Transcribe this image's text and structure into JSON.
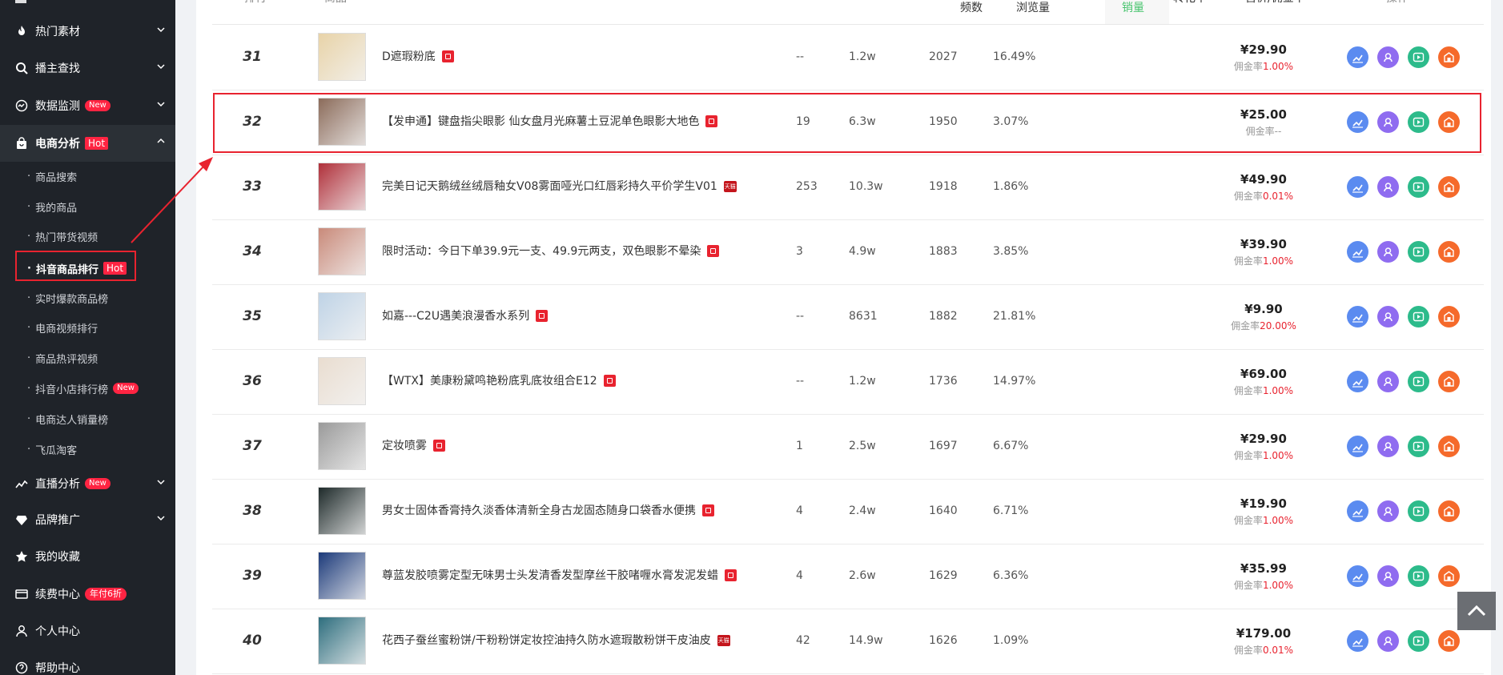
{
  "sidebar": {
    "items": [
      {
        "label": "热门素材",
        "icon": "fire-icon",
        "badge": ""
      },
      {
        "label": "播主查找",
        "icon": "search-icon",
        "badge": ""
      },
      {
        "label": "数据监测",
        "icon": "monitor-icon",
        "badge": "New"
      },
      {
        "label": "电商分析",
        "icon": "shopping-bag-icon",
        "badge": "Hot"
      },
      {
        "label": "直播分析",
        "icon": "live-chart-icon",
        "badge": "New"
      },
      {
        "label": "品牌推广",
        "icon": "diamond-icon",
        "badge": ""
      },
      {
        "label": "我的收藏",
        "icon": "star-icon",
        "badge": ""
      },
      {
        "label": "续费中心",
        "icon": "card-icon",
        "badge": "年付6折"
      },
      {
        "label": "个人中心",
        "icon": "user-icon",
        "badge": ""
      },
      {
        "label": "帮助中心",
        "icon": "help-icon",
        "badge": ""
      }
    ],
    "sub_items": [
      {
        "label": "商品搜索",
        "badge": ""
      },
      {
        "label": "我的商品",
        "badge": ""
      },
      {
        "label": "热门带货视频",
        "badge": ""
      },
      {
        "label": "抖音商品排行",
        "badge": "Hot"
      },
      {
        "label": "实时爆款商品榜",
        "badge": ""
      },
      {
        "label": "电商视频排行",
        "badge": ""
      },
      {
        "label": "商品热评视频",
        "badge": ""
      },
      {
        "label": "抖音小店排行榜",
        "badge": "New"
      },
      {
        "label": "电商达人销量榜",
        "badge": ""
      },
      {
        "label": "飞瓜淘客",
        "badge": ""
      }
    ],
    "dot": "·"
  },
  "table": {
    "headers": {
      "rank": "排行",
      "product": "商品",
      "frequency": "频数",
      "views": "浏览量",
      "sales": "销量",
      "conversion": "转化率",
      "price": "售价/佣金率",
      "actions": "操作"
    },
    "commission_prefix": "佣金率",
    "rows": [
      {
        "rank": "31",
        "name": "D遮瑕粉底",
        "tag": "shop",
        "freq": "--",
        "views": "1.2w",
        "sales": "2027",
        "conv": "16.49%",
        "price": "¥29.90",
        "commission": "1.00%",
        "thumb": "#e8d3a8"
      },
      {
        "rank": "32",
        "name": "【发申通】键盘指尖眼影 仙女盘月光麻薯土豆泥单色眼影大地色",
        "tag": "shop",
        "freq": "19",
        "views": "6.3w",
        "sales": "1950",
        "conv": "3.07%",
        "price": "¥25.00",
        "commission": "--",
        "thumb": "#8b6b5a"
      },
      {
        "rank": "33",
        "name": "完美日记天鹅绒丝绒唇釉女V08雾面哑光口红唇彩持久平价学生V01",
        "tag": "tmall",
        "freq": "253",
        "views": "10.3w",
        "sales": "1918",
        "conv": "1.86%",
        "price": "¥49.90",
        "commission": "0.01%",
        "thumb": "#b0303a"
      },
      {
        "rank": "34",
        "name": "限时活动：今日下单39.9元一支、49.9元两支，双色眼影不晕染",
        "tag": "shop",
        "freq": "3",
        "views": "4.9w",
        "sales": "1883",
        "conv": "3.85%",
        "price": "¥39.90",
        "commission": "1.00%",
        "thumb": "#c98a7a"
      },
      {
        "rank": "35",
        "name": "如嘉---C2U遇美浪漫香水系列",
        "tag": "shop",
        "freq": "--",
        "views": "8631",
        "sales": "1882",
        "conv": "21.81%",
        "price": "¥9.90",
        "commission": "20.00%",
        "thumb": "#bfd3e6"
      },
      {
        "rank": "36",
        "name": "【WTX】美康粉黛鸣艳粉底乳底妆组合E12",
        "tag": "shop",
        "freq": "--",
        "views": "1.2w",
        "sales": "1736",
        "conv": "14.97%",
        "price": "¥69.00",
        "commission": "1.00%",
        "thumb": "#e9ddd0"
      },
      {
        "rank": "37",
        "name": "定妆喷雾",
        "tag": "shop",
        "freq": "1",
        "views": "2.5w",
        "sales": "1697",
        "conv": "6.67%",
        "price": "¥29.90",
        "commission": "1.00%",
        "thumb": "#9a9a9a"
      },
      {
        "rank": "38",
        "name": "男女士固体香膏持久淡香体清新全身古龙固态随身口袋香水便携",
        "tag": "shop",
        "freq": "4",
        "views": "2.4w",
        "sales": "1640",
        "conv": "6.71%",
        "price": "¥19.90",
        "commission": "1.00%",
        "thumb": "#1e2a2a"
      },
      {
        "rank": "39",
        "name": "尊蓝发胶喷雾定型无味男士头发清香发型摩丝干胶啫喱水膏发泥发蜡",
        "tag": "shop",
        "freq": "4",
        "views": "2.6w",
        "sales": "1629",
        "conv": "6.36%",
        "price": "¥35.99",
        "commission": "1.00%",
        "thumb": "#1c3a7a"
      },
      {
        "rank": "40",
        "name": "花西子蚕丝蜜粉饼/干粉粉饼定妆控油持久防水遮瑕散粉饼干皮油皮",
        "tag": "tmall",
        "freq": "42",
        "views": "14.9w",
        "sales": "1626",
        "conv": "1.09%",
        "price": "¥179.00",
        "commission": "0.01%",
        "thumb": "#2e6e7e"
      }
    ],
    "tmall_label": "天猫"
  },
  "colors": {
    "accent_red": "#e8232f",
    "sales_green": "#48c46e",
    "sidebar_bg": "#1f2329"
  },
  "action_icons": [
    "trend-chart-icon",
    "user-profile-icon",
    "play-video-icon",
    "shop-home-icon"
  ]
}
